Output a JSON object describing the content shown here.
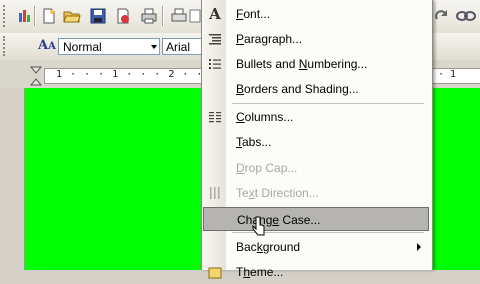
{
  "toolbar": {
    "style_value": "Normal",
    "font_value": "Arial"
  },
  "ruler": {
    "left_text": "1 · · · 1 · · · 2 · · · 3",
    "right_text": "· 1"
  },
  "format_menu": {
    "items": [
      {
        "label": "Font...",
        "accel": "F",
        "icon": "font-a-icon",
        "enabled": true
      },
      {
        "label": "Paragraph...",
        "accel": "P",
        "icon": "paragraph-icon",
        "enabled": true
      },
      {
        "label": "Bullets and Numbering...",
        "accel": "N",
        "icon": "bullets-icon",
        "enabled": true
      },
      {
        "label": "Borders and Shading...",
        "accel": "B",
        "icon": "",
        "enabled": true
      },
      {
        "label": "Columns...",
        "accel": "C",
        "icon": "columns-icon",
        "enabled": true
      },
      {
        "label": "Tabs...",
        "accel": "T",
        "icon": "",
        "enabled": true
      },
      {
        "label": "Drop Cap...",
        "accel": "D",
        "icon": "",
        "enabled": false
      },
      {
        "label": "Text Direction...",
        "accel": "x",
        "icon": "text-direction-icon",
        "enabled": false
      },
      {
        "label": "Change Case...",
        "accel": "e",
        "icon": "",
        "enabled": true,
        "highlighted": true
      },
      {
        "label": "Background",
        "accel": "k",
        "icon": "",
        "enabled": true,
        "submenu": true
      },
      {
        "label": "Theme...",
        "accel": "h",
        "icon": "theme-icon",
        "enabled": true
      }
    ]
  },
  "colors": {
    "document_bg": "#00ff00",
    "menu_highlight": "#b5b4b0"
  }
}
